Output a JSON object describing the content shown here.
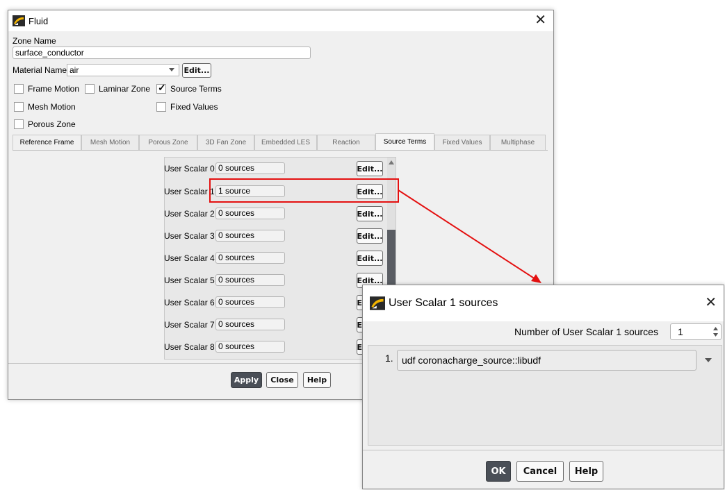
{
  "fluid_dialog": {
    "title": "Fluid",
    "zone_name_label": "Zone Name",
    "zone_name_value": "surface_conductor",
    "material_name_label": "Material Name",
    "material_name_value": "air",
    "material_edit_label": "Edit...",
    "checkboxes": [
      {
        "label": "Frame Motion",
        "checked": false
      },
      {
        "label": "Laminar Zone",
        "checked": false
      },
      {
        "label": "Source Terms",
        "checked": true
      },
      {
        "label": "Mesh Motion",
        "checked": false
      },
      {
        "label": "Fixed Values",
        "checked": false
      },
      {
        "label": "Porous Zone",
        "checked": false
      }
    ],
    "tabs": [
      "Reference Frame",
      "Mesh Motion",
      "Porous Zone",
      "3D Fan Zone",
      "Embedded LES",
      "Reaction",
      "Source Terms",
      "Fixed Values",
      "Multiphase"
    ],
    "active_tab": "Source Terms",
    "scalars": [
      {
        "label": "User Scalar 0",
        "value": "0 sources",
        "edit": "Edit..."
      },
      {
        "label": "User Scalar 1",
        "value": "1 source",
        "edit": "Edit..."
      },
      {
        "label": "User Scalar 2",
        "value": "0 sources",
        "edit": "Edit..."
      },
      {
        "label": "User Scalar 3",
        "value": "0 sources",
        "edit": "Edit..."
      },
      {
        "label": "User Scalar 4",
        "value": "0 sources",
        "edit": "Edit..."
      },
      {
        "label": "User Scalar 5",
        "value": "0 sources",
        "edit": "Edit..."
      },
      {
        "label": "User Scalar 6",
        "value": "0 sources",
        "edit": "Edit..."
      },
      {
        "label": "User Scalar 7",
        "value": "0 sources",
        "edit": "Edit..."
      },
      {
        "label": "User Scalar 8",
        "value": "0 sources",
        "edit": "Edit..."
      }
    ],
    "apply_label": "Apply",
    "close_label": "Close",
    "help_label": "Help"
  },
  "sources_dialog": {
    "title": "User Scalar 1 sources",
    "count_label": "Number of User Scalar 1 sources",
    "count_value": "1",
    "entry_index": "1.",
    "entry_value": "udf coronacharge_source::libudf",
    "ok_label": "OK",
    "cancel_label": "Cancel",
    "help_label": "Help"
  },
  "colors": {
    "highlight": "#e41010",
    "primary_button": "#4a4f57",
    "dialog_background": "#f0f0f0"
  },
  "icons": {
    "app": "ansys-fluent-icon",
    "close": "close-icon",
    "dropdown": "chevron-down-icon",
    "spinner": "spinner-icon"
  }
}
